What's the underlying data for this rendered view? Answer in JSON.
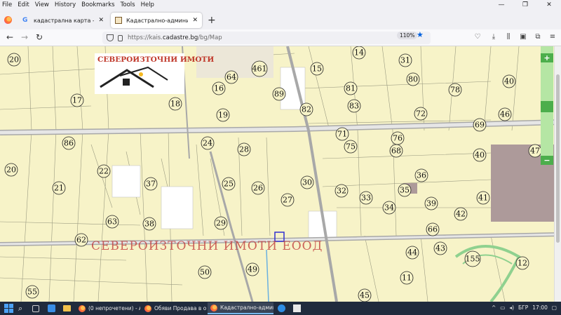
{
  "menu": [
    "File",
    "Edit",
    "View",
    "History",
    "Bookmarks",
    "Tools",
    "Help"
  ],
  "window_controls": {
    "minimize": "—",
    "restore": "❐",
    "close": "✕"
  },
  "tabs": [
    {
      "title": "кадастрална карта - Google Търс",
      "favicon": "google-icon",
      "close": "✕"
    },
    {
      "title": "Кадастрално-административна",
      "favicon": "cadastre-icon",
      "close": "✕",
      "active": true
    }
  ],
  "new_tab": "+",
  "nav": {
    "back": "←",
    "forward": "→",
    "reload": "↻",
    "url_prefix": "https://kais.",
    "url_domain": "cadastre.bg",
    "url_path": "/bg/Map",
    "zoom": "110%",
    "bookmark_star": "★",
    "right_icons": [
      "♡",
      "⤓",
      "⫼",
      "▣",
      "⧉",
      "≡"
    ]
  },
  "map": {
    "logo_title": "СЕВЕРОИЗТОЧНИ ИМОТИ",
    "watermark": "СЕВЕРОИЗТОЧНИ ИМОТИ ЕООД",
    "zoom_in": "+",
    "zoom_out": "−",
    "parcels": [
      "20",
      "17",
      "86",
      "20",
      "21",
      "22",
      "37",
      "62",
      "63",
      "38",
      "55",
      "64",
      "461",
      "16",
      "18",
      "19",
      "24",
      "28",
      "25",
      "26",
      "29",
      "50",
      "49",
      "89",
      "82",
      "15",
      "14",
      "81",
      "83",
      "71",
      "75",
      "30",
      "27",
      "32",
      "33",
      "31",
      "80",
      "78",
      "40",
      "72",
      "76",
      "68",
      "46",
      "69",
      "40",
      "47",
      "36",
      "35",
      "39",
      "34",
      "41",
      "42",
      "66",
      "43",
      "44",
      "155",
      "12",
      "11",
      "45"
    ]
  },
  "taskbar": {
    "search_icon": "⌕",
    "apps": [
      {
        "label": "(0 непрочетени) - АБ..."
      },
      {
        "label": "Обяви Продава в об..."
      },
      {
        "label": "Кадастрално-админ...",
        "active": true
      }
    ],
    "language": "БГР",
    "time": "17:00"
  },
  "colors": {
    "map_bg": "#f7f3c8",
    "road": "#a0a0a0",
    "watermark": "#c0392b",
    "zoom_green": "#4cae4c"
  }
}
